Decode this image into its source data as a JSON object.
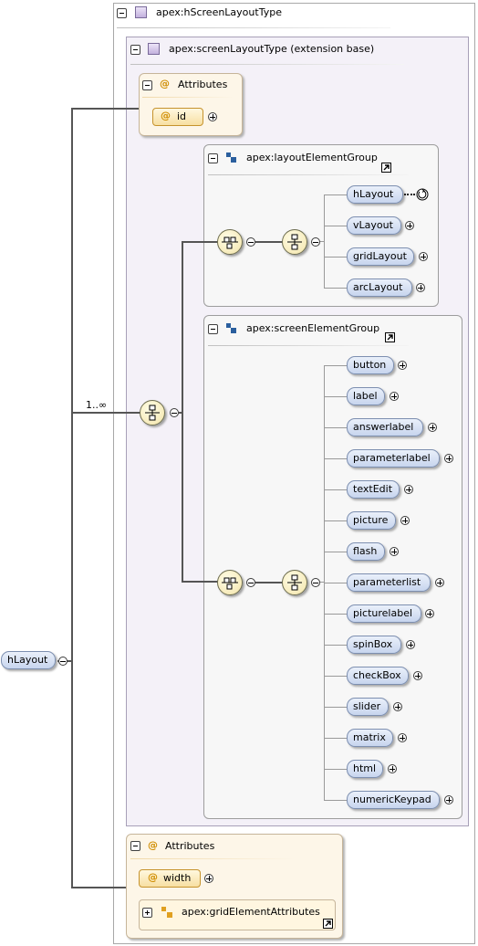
{
  "root": {
    "label": "apex:hScreenLayoutType"
  },
  "extension": {
    "label": "apex:screenLayoutType (extension base)"
  },
  "attributes_top": {
    "title": "Attributes",
    "id_label": "id"
  },
  "layout_group": {
    "label": "apex:layoutElementGroup",
    "items": [
      "hLayout",
      "vLayout",
      "gridLayout",
      "arcLayout"
    ]
  },
  "screen_group": {
    "label": "apex:screenElementGroup",
    "items": [
      "button",
      "label",
      "answerlabel",
      "parameterlabel",
      "textEdit",
      "picture",
      "flash",
      "parameterlist",
      "picturelabel",
      "spinBox",
      "checkBox",
      "slider",
      "matrix",
      "html",
      "numericKeypad"
    ]
  },
  "multiplicity": "1..∞",
  "element": {
    "label": "hLayout"
  },
  "attributes_bottom": {
    "title": "Attributes",
    "width_label": "width",
    "group_label": "apex:gridElementAttributes"
  },
  "colors": {
    "extension_bg": "#f4f1f8",
    "attr_bg": "#fdf6e8",
    "pill_border": "#7d8fb0",
    "attr_border": "#c6932d"
  },
  "icons": {
    "complex_type": "purple-square-icon",
    "group": "group-icon",
    "attribute": "at-icon",
    "recursion": "recursion-icon",
    "link": "link-arrow-icon"
  }
}
